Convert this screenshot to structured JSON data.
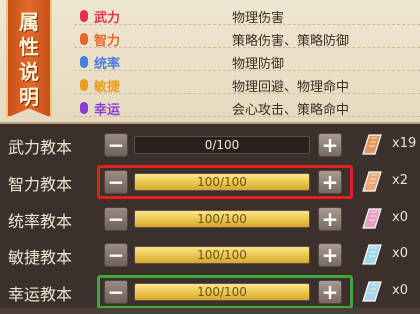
{
  "banner": {
    "title": "属性说明",
    "color": "#e05a20"
  },
  "legend": [
    {
      "attr": "武力",
      "desc": "物理伤害",
      "color": "#e0324a"
    },
    {
      "attr": "智力",
      "desc": "策略伤害、策略防御",
      "color": "#e8652a"
    },
    {
      "attr": "统率",
      "desc": "物理防御",
      "color": "#4a7de0"
    },
    {
      "attr": "敏捷",
      "desc": "物理回避、物理命中",
      "color": "#e8a020"
    },
    {
      "attr": "幸运",
      "desc": "会心攻击、策略命中",
      "color": "#8a3ad8"
    }
  ],
  "stats": [
    {
      "label": "武力教本",
      "progress": "0/100",
      "fill": 0,
      "count": "x19",
      "book_color": "#e09a60",
      "highlight": "none"
    },
    {
      "label": "智力教本",
      "progress": "100/100",
      "fill": 1,
      "count": "x2",
      "book_color": "#e8a87a",
      "highlight": "red"
    },
    {
      "label": "统率教本",
      "progress": "100/100",
      "fill": 1,
      "count": "x0",
      "book_color": "#e6a0c0",
      "highlight": "none"
    },
    {
      "label": "敏捷教本",
      "progress": "100/100",
      "fill": 1,
      "count": "x0",
      "book_color": "#9fd8e6",
      "highlight": "none"
    },
    {
      "label": "幸运教本",
      "progress": "100/100",
      "fill": 1,
      "count": "x0",
      "book_color": "#a8d4ec",
      "highlight": "green"
    }
  ],
  "buttons": {
    "minus": "−",
    "plus": "+"
  }
}
